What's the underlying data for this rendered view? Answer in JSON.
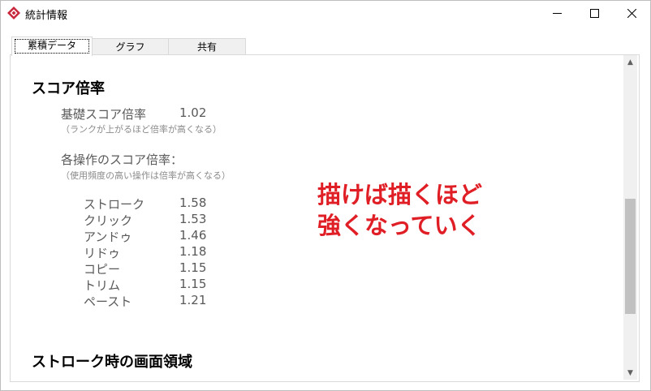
{
  "window": {
    "title": "統計情報",
    "minimize_glyph": "—",
    "maximize_glyph": "☐",
    "close_glyph": "✕"
  },
  "tabs": [
    {
      "label": "累積データ",
      "active": true
    },
    {
      "label": "グラフ",
      "active": false
    },
    {
      "label": "共有",
      "active": false
    }
  ],
  "scrollbar": {
    "up_glyph": "▲",
    "down_glyph": "▼",
    "position_fraction": 0.58
  },
  "content": {
    "section1_title": "スコア倍率",
    "base_label": "基礎スコア倍率",
    "base_value": "1.02",
    "base_note": "（ランクが上がるほど倍率が高くなる）",
    "ops_label": "各操作のスコア倍率：",
    "ops_note": "（使用頻度の高い操作は倍率が高くなる）",
    "operations": [
      {
        "name": "ストローク",
        "value": "1.58"
      },
      {
        "name": "クリック",
        "value": "1.53"
      },
      {
        "name": "アンドゥ",
        "value": "1.46"
      },
      {
        "name": "リドゥ",
        "value": "1.18"
      },
      {
        "name": "コピー",
        "value": "1.15"
      },
      {
        "name": "トリム",
        "value": "1.15"
      },
      {
        "name": "ペースト",
        "value": "1.21"
      }
    ],
    "section2_title": "ストローク時の画面領域"
  },
  "callout": {
    "line1": "描けば描くほど",
    "line2": "強くなっていく",
    "color": "#e01e25"
  },
  "colors": {
    "app_icon": "#c8283c",
    "accent_text": "#e01e25"
  }
}
